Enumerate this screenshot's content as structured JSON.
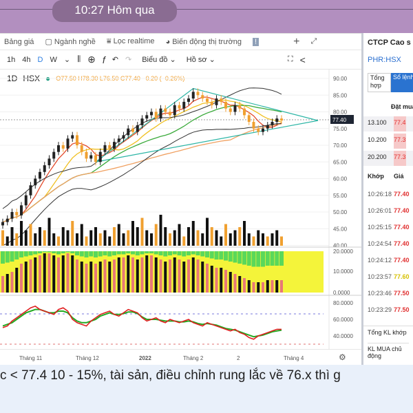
{
  "chat": {
    "timestamp": "10:27 Hôm qua",
    "message": "c < 77.4 10 - 15%, tài sản, điều chỉnh rung lắc về 76.x thì g"
  },
  "toolbar1": {
    "items": [
      "Bảng giá",
      "Ngành nghề",
      "Lọc realtime",
      "Biến động thị trường"
    ],
    "plus": "+"
  },
  "toolbar2": {
    "intervals": [
      "1h",
      "4h",
      "D",
      "W"
    ],
    "active": "D",
    "fx": "f",
    "chart_menu": "Biểu đồ ⌄",
    "profile_menu": "Hồ sơ ⌄"
  },
  "legend": {
    "interval": "1D",
    "exchange": "HSX",
    "ohlc": "O77.50 H78.30 L76.50 C77.40 −0.20 (−0.26%)"
  },
  "axes": {
    "price_ticks": [
      "90.00",
      "85.00",
      "80.00",
      "75.00",
      "70.00",
      "65.00",
      "60.00",
      "55.00",
      "50.00",
      "45.00",
      "40.00"
    ],
    "last_price": "77.40",
    "ind1_ticks": [
      "20.0000",
      "10.0000",
      "0.0000"
    ],
    "ind2_ticks": [
      "80.0000",
      "60.0000",
      "40.0000"
    ],
    "time_labels": [
      "Tháng 11",
      "Tháng 12",
      "2022",
      "Tháng 2",
      "2",
      "Tháng 4"
    ]
  },
  "chart_data": {
    "type": "candlestick",
    "closes": [
      47,
      48,
      50,
      49,
      52,
      55,
      58,
      60,
      62,
      64,
      66,
      68,
      70,
      69,
      72,
      73,
      70,
      68,
      66,
      67,
      65,
      68,
      70,
      69,
      71,
      72,
      73,
      75,
      74,
      76,
      78,
      79,
      80,
      78,
      81,
      80,
      79,
      82,
      81,
      83,
      84,
      86,
      85,
      84,
      83,
      82,
      84,
      83,
      81,
      80,
      82,
      81,
      79,
      77,
      75,
      74,
      75,
      76,
      77,
      78,
      77.4
    ],
    "volumes": [
      0.5,
      0.3,
      0.6,
      0.4,
      0.8,
      0.5,
      0.7,
      0.4,
      0.6,
      0.5,
      0.9,
      0.4,
      0.3,
      0.6,
      0.5,
      0.8,
      0.4,
      0.7,
      0.3,
      0.5,
      0.6,
      0.4,
      0.5,
      0.3,
      0.6,
      0.7,
      0.4,
      0.5,
      0.8,
      0.6,
      0.9,
      0.5,
      0.4,
      0.7,
      1.0,
      0.6,
      0.4,
      0.5,
      0.7,
      0.3,
      0.6,
      0.8,
      0.5,
      0.4,
      0.9,
      0.6,
      0.5,
      0.3,
      0.7,
      0.4,
      0.5,
      0.6,
      0.8,
      0.4,
      0.3,
      0.5,
      0.4,
      0.3,
      0.4,
      0.5,
      0.3
    ],
    "ind1": [
      8,
      9,
      10,
      12,
      14,
      15,
      16,
      17,
      18,
      19,
      19,
      18,
      17,
      18,
      19,
      18,
      16,
      15,
      14,
      15,
      14,
      15,
      16,
      15,
      16,
      17,
      17,
      18,
      17,
      16,
      17,
      18,
      18,
      17,
      16,
      15,
      16,
      17,
      16,
      15,
      16,
      17,
      16,
      15,
      14,
      13,
      12,
      12,
      11,
      10,
      9,
      8,
      7,
      6,
      5,
      5,
      5,
      6,
      6,
      6,
      6
    ],
    "ind2_fast": [
      50,
      52,
      58,
      62,
      66,
      70,
      74,
      76,
      72,
      70,
      68,
      66,
      72,
      74,
      70,
      60,
      56,
      54,
      52,
      58,
      62,
      66,
      68,
      70,
      66,
      64,
      68,
      72,
      70,
      68,
      62,
      58,
      60,
      62,
      58,
      56,
      60,
      58,
      56,
      58,
      60,
      56,
      54,
      52,
      56,
      54,
      52,
      50,
      48,
      46,
      48,
      44,
      42,
      38,
      36,
      40,
      42,
      44,
      46,
      48,
      48
    ],
    "ind2_slow": [
      52,
      54,
      56,
      60,
      64,
      68,
      70,
      72,
      72,
      70,
      68,
      68,
      70,
      70,
      68,
      62,
      58,
      56,
      56,
      58,
      60,
      64,
      66,
      68,
      66,
      66,
      67,
      69,
      69,
      67,
      63,
      60,
      60,
      60,
      59,
      58,
      58,
      58,
      57,
      57,
      58,
      57,
      55,
      54,
      55,
      54,
      53,
      51,
      49,
      48,
      47,
      45,
      43,
      41,
      39,
      40,
      41,
      43,
      45,
      46,
      47
    ]
  },
  "panel": {
    "company": "CTCP Cao s",
    "ticker": "PHR:HSX",
    "tab_summary": "Tổng hợp",
    "tab_orders": "Sổ lệnh",
    "order_header": "Đặt mua",
    "orders": [
      {
        "qty": "13.100",
        "price": "77.4"
      },
      {
        "qty": "10.200",
        "price": "77.3"
      },
      {
        "qty": "20.200",
        "price": "77.3"
      }
    ],
    "trade_header": {
      "time": "Khớp",
      "price": "Giá"
    },
    "trades": [
      {
        "time": "10:26:18",
        "price": "77.40",
        "c": "red"
      },
      {
        "time": "10:26:01",
        "price": "77.40",
        "c": "red"
      },
      {
        "time": "10:25:15",
        "price": "77.40",
        "c": "red"
      },
      {
        "time": "10:24:54",
        "price": "77.40",
        "c": "red"
      },
      {
        "time": "10:24:12",
        "price": "77.40",
        "c": "red"
      },
      {
        "time": "10:23:57",
        "price": "77.60",
        "c": "yel"
      },
      {
        "time": "10:23:46",
        "price": "77.50",
        "c": "red"
      },
      {
        "time": "10:23:29",
        "price": "77.50",
        "c": "red"
      }
    ],
    "total_label": "Tổng KL khớp",
    "buy_active_label": "KL MUA chủ động"
  }
}
